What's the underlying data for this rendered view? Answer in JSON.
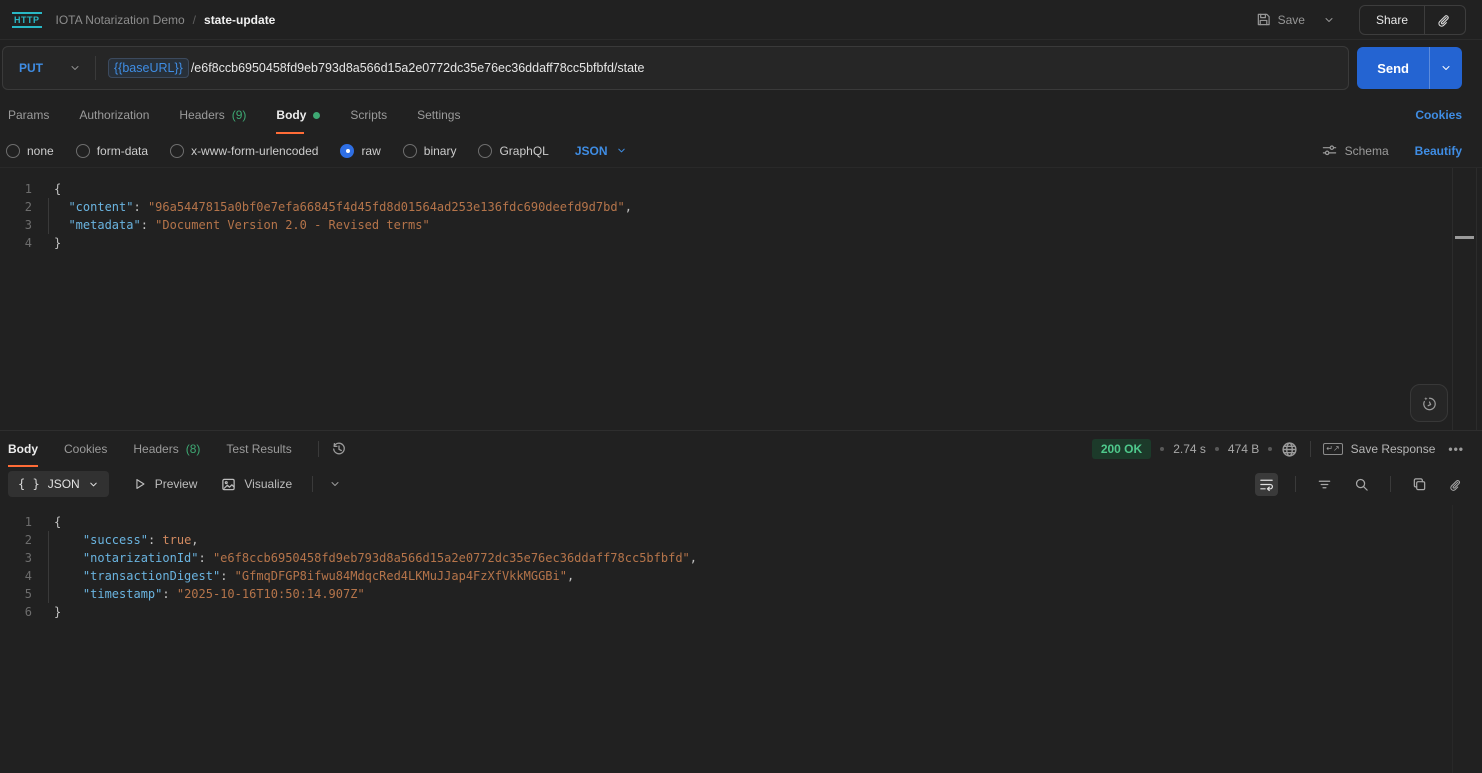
{
  "topbar": {
    "logo": "HTTP",
    "collection": "IOTA Notarization Demo",
    "separator": "/",
    "request_name": "state-update",
    "save_label": "Save",
    "share_label": "Share"
  },
  "request": {
    "method": "PUT",
    "url_variable": "{{baseURL}}",
    "url_path": "/e6f8ccb6950458fd9eb793d8a566d15a2e0772dc35e76ec36ddaff78cc5bfbfd/state",
    "send_label": "Send",
    "tabs": [
      {
        "label": "Params"
      },
      {
        "label": "Authorization"
      },
      {
        "label": "Headers",
        "count": "(9)"
      },
      {
        "label": "Body"
      },
      {
        "label": "Scripts"
      },
      {
        "label": "Settings"
      }
    ],
    "active_tab": "Body",
    "cookies_link": "Cookies",
    "body_modes": [
      {
        "label": "none"
      },
      {
        "label": "form-data"
      },
      {
        "label": "x-www-form-urlencoded"
      },
      {
        "label": "raw"
      },
      {
        "label": "binary"
      },
      {
        "label": "GraphQL"
      }
    ],
    "selected_mode": "raw",
    "language": "JSON",
    "schema_label": "Schema",
    "beautify_label": "Beautify",
    "body_lines": [
      [
        [
          "p",
          "{"
        ]
      ],
      [
        [
          "ws",
          "  "
        ],
        [
          "k",
          "\"content\""
        ],
        [
          "p",
          ": "
        ],
        [
          "s",
          "\"96a5447815a0bf0e7efa66845f4d45fd8d01564ad253e136fdc690deefd9d7bd\""
        ],
        [
          "p",
          ","
        ]
      ],
      [
        [
          "ws",
          "  "
        ],
        [
          "k",
          "\"metadata\""
        ],
        [
          "p",
          ": "
        ],
        [
          "s",
          "\"Document Version 2.0 - Revised terms\""
        ]
      ],
      [
        [
          "p",
          "}"
        ]
      ]
    ]
  },
  "response": {
    "tabs": [
      {
        "label": "Body"
      },
      {
        "label": "Cookies"
      },
      {
        "label": "Headers",
        "count": "(8)"
      },
      {
        "label": "Test Results"
      }
    ],
    "active_tab": "Body",
    "status": "200 OK",
    "time": "2.74 s",
    "size": "474 B",
    "save_response_label": "Save Response",
    "format_braces": "{ }",
    "format": "JSON",
    "preview_label": "Preview",
    "visualize_label": "Visualize",
    "body_lines": [
      [
        [
          "p",
          "{"
        ]
      ],
      [
        [
          "ws",
          "    "
        ],
        [
          "k",
          "\"success\""
        ],
        [
          "p",
          ": "
        ],
        [
          "b",
          "true"
        ],
        [
          "p",
          ","
        ]
      ],
      [
        [
          "ws",
          "    "
        ],
        [
          "k",
          "\"notarizationId\""
        ],
        [
          "p",
          ": "
        ],
        [
          "s",
          "\"e6f8ccb6950458fd9eb793d8a566d15a2e0772dc35e76ec36ddaff78cc5bfbfd\""
        ],
        [
          "p",
          ","
        ]
      ],
      [
        [
          "ws",
          "    "
        ],
        [
          "k",
          "\"transactionDigest\""
        ],
        [
          "p",
          ": "
        ],
        [
          "s",
          "\"GfmqDFGP8ifwu84MdqcRed4LKMuJJap4FzXfVkkMGGBi\""
        ],
        [
          "p",
          ","
        ]
      ],
      [
        [
          "ws",
          "    "
        ],
        [
          "k",
          "\"timestamp\""
        ],
        [
          "p",
          ": "
        ],
        [
          "s",
          "\"2025-10-16T10:50:14.907Z\""
        ]
      ],
      [
        [
          "p",
          "}"
        ]
      ]
    ]
  },
  "colors": {
    "accent_orange": "#ff6c37",
    "accent_blue": "#3f8de4",
    "send_blue": "#2464d2",
    "success_green": "#4fc98c",
    "logo_teal": "#29b8c5"
  }
}
